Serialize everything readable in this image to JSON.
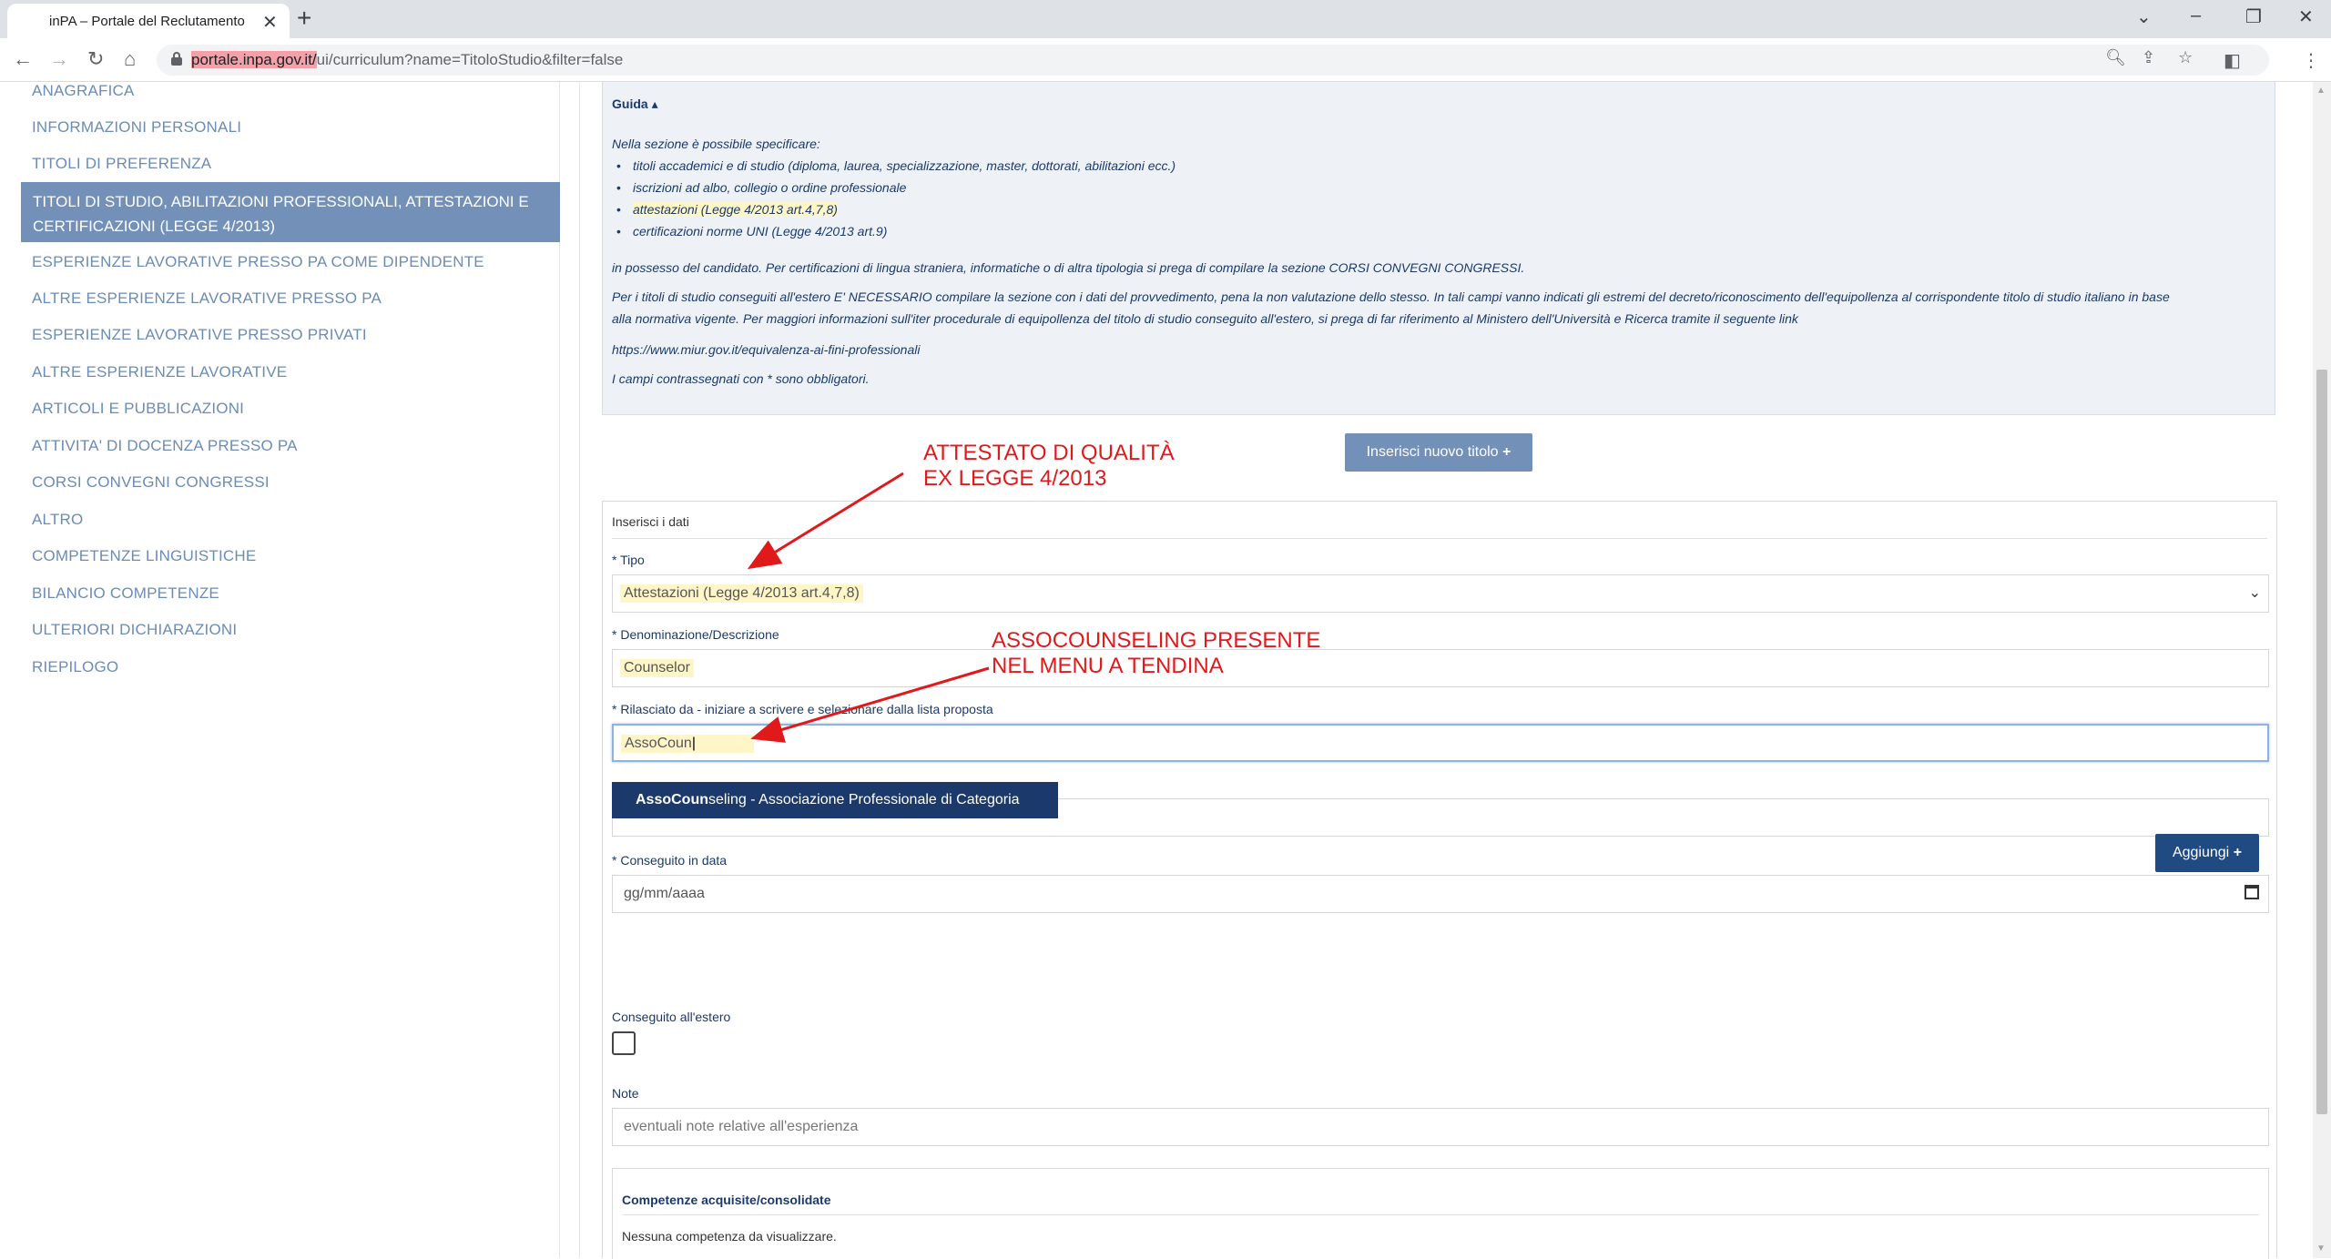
{
  "browser": {
    "tab_title": "inPA – Portale del Reclutamento",
    "url_host": "portale.inpa.gov.it/",
    "url_path": "ui/curriculum?name=TitoloStudio&filter=false"
  },
  "sidebar": {
    "items": [
      "ANAGRAFICA",
      "INFORMAZIONI PERSONALI",
      "TITOLI DI PREFERENZA",
      "TITOLI DI STUDIO, ABILITAZIONI PROFESSIONALI, ATTESTAZIONI E CERTIFICAZIONI (LEGGE 4/2013)",
      "ESPERIENZE LAVORATIVE PRESSO PA COME DIPENDENTE",
      "ALTRE ESPERIENZE LAVORATIVE PRESSO PA",
      "ESPERIENZE LAVORATIVE PRESSO PRIVATI",
      "ALTRE ESPERIENZE LAVORATIVE",
      "ARTICOLI E PUBBLICAZIONI",
      "ATTIVITA' DI DOCENZA PRESSO PA",
      "CORSI CONVEGNI CONGRESSI",
      "ALTRO",
      "COMPETENZE LINGUISTICHE",
      "BILANCIO COMPETENZE",
      "ULTERIORI DICHIARAZIONI",
      "RIEPILOGO"
    ],
    "active_index": 3
  },
  "guide": {
    "toggle_label": "Guida",
    "intro": "Nella sezione è possibile specificare:",
    "bullets": [
      "titoli accademici e di studio (diploma, laurea, specializzazione, master, dottorati, abilitazioni ecc.)",
      "iscrizioni ad albo, collegio o ordine professionale",
      "attestazioni (Legge 4/2013 art.4,7,8)",
      "certificazioni norme UNI (Legge 4/2013 art.9)"
    ],
    "para1": "in possesso del candidato. Per certificazioni di lingua straniera, informatiche o di altra tipologia si prega di compilare la sezione CORSI CONVEGNI CONGRESSI.",
    "para2a": "Per i titoli di studio conseguiti all'estero E' NECESSARIO compilare la sezione con i dati del provvedimento, pena la non valutazione dello stesso. In tali campi vanno indicati gli estremi del decreto/riconoscimento dell'equipollenza al corrispondente titolo di studio italiano in base",
    "para2b": "alla normativa vigente. Per maggiori informazioni sull'iter procedurale di equipollenza del titolo di studio conseguito all'estero, si prega di far riferimento al Ministero dell'Università e Ricerca tramite il seguente link",
    "link": "https://www.miur.gov.it/equivalenza-ai-fini-professionali",
    "required_note": "I campi contrassegnati con * sono obbligatori."
  },
  "insert_button": "Inserisci nuovo titolo",
  "form": {
    "title": "Inserisci i dati",
    "tipo_label": "* Tipo",
    "tipo_value": "Attestazioni (Legge 4/2013 art.4,7,8)",
    "denominazione_label": "* Denominazione/Descrizione",
    "denominazione_value": "Counselor",
    "rilasciato_label": "* Rilasciato da - iniziare a scrivere e selezionare dalla lista proposta",
    "rilasciato_value": "AssoCoun",
    "suggestion_match": "AssoCoun",
    "suggestion_rest": "seling - Associazione Professionale di Categoria",
    "data_label": "* Conseguito in data",
    "data_placeholder": "gg/mm/aaaa",
    "estero_label": "Conseguito all'estero",
    "note_label": "Note",
    "note_placeholder": "eventuali note relative all'esperienza"
  },
  "competenze": {
    "title": "Competenze acquisite/consolidate",
    "empty": "Nessuna competenza da visualizzare.",
    "add_button": "Aggiungi"
  },
  "annotations": {
    "a1_line1": "ATTESTATO DI QUALITÀ",
    "a1_line2": "EX LEGGE 4/2013",
    "a2_line1": "ASSOCOUNSELING PRESENTE",
    "a2_line2": "NEL MENU A TENDINA",
    "color": "#e0191b"
  }
}
